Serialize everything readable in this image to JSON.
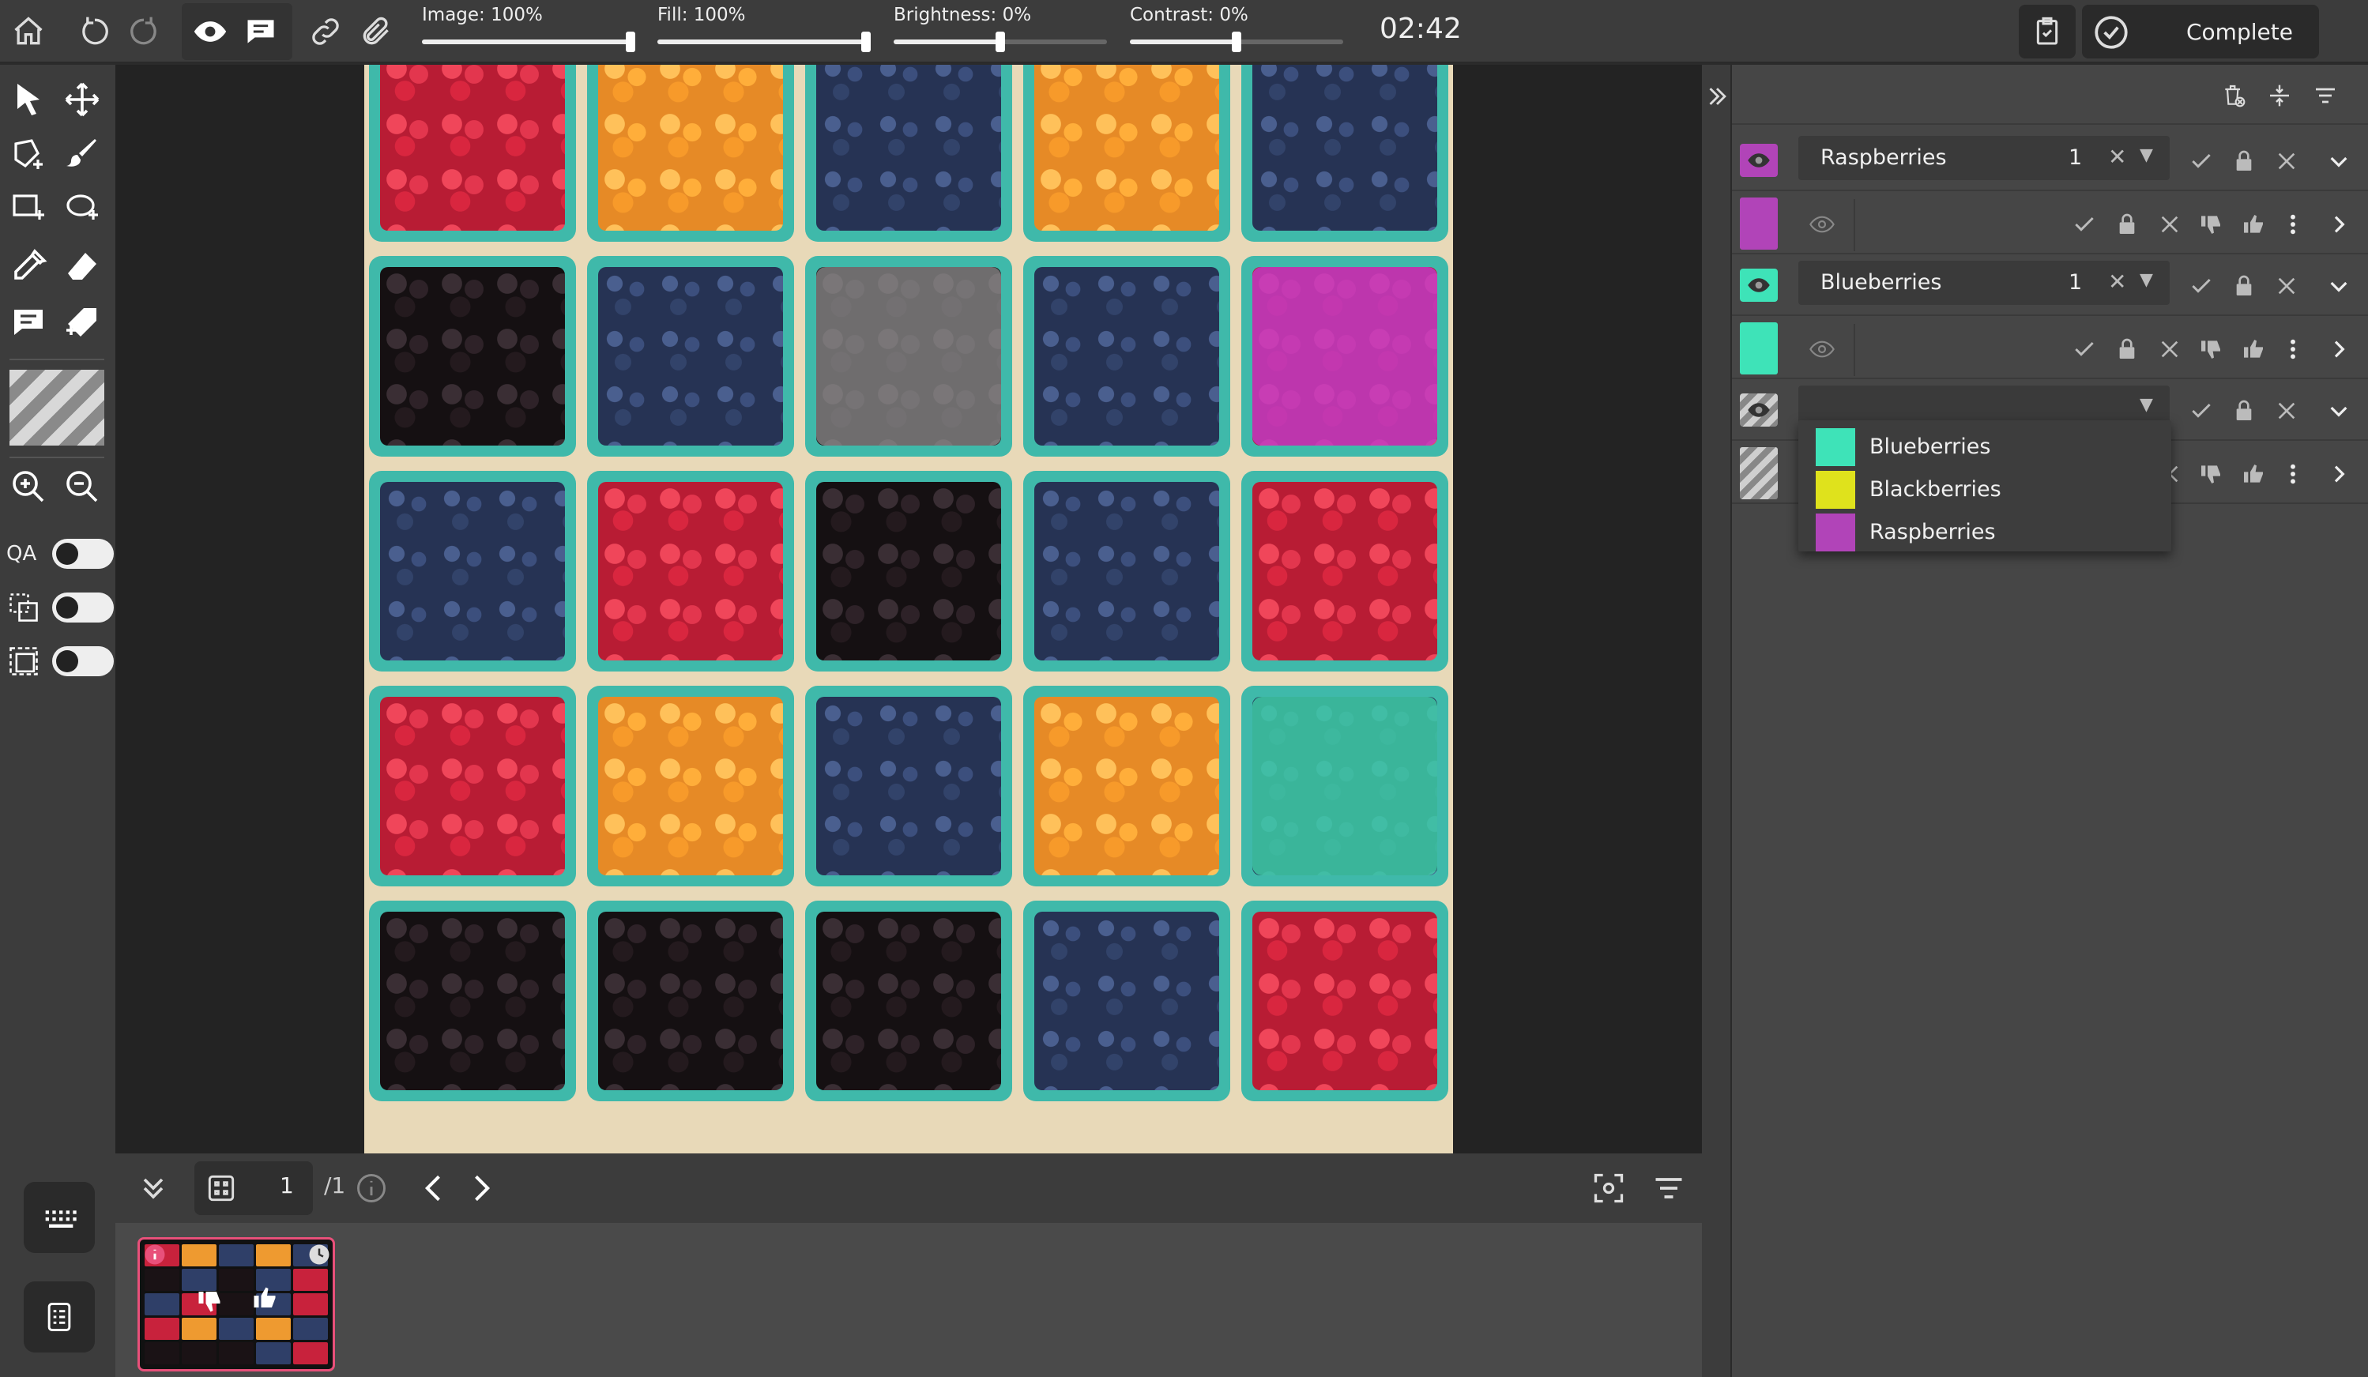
{
  "toolbar": {
    "sliders": [
      {
        "label": "Image: 100%",
        "value": 1.0
      },
      {
        "label": "Fill: 100%",
        "value": 1.0
      },
      {
        "label": "Brightness: 0%",
        "value": 0.5
      },
      {
        "label": "Contrast: 0%",
        "value": 0.5
      }
    ],
    "timer": "02:42",
    "complete_label": "Complete"
  },
  "left_tools": {
    "qa_label": "QA"
  },
  "pager": {
    "current_page": "1",
    "total_pages": "/1"
  },
  "right_panel": {
    "annotations": [
      {
        "class": "Raspberries",
        "count": "1",
        "color": "#b144b8"
      },
      {
        "class": "Blueberries",
        "count": "1",
        "color": "#3ee3b8"
      },
      {
        "class": "",
        "count": "",
        "color": "#9a9a9a"
      }
    ],
    "class_options": [
      {
        "label": "Blueberries",
        "color": "#3ee3b8"
      },
      {
        "label": "Blackberries",
        "color": "#dfe21c"
      },
      {
        "label": "Raspberries",
        "color": "#b144b8"
      }
    ]
  },
  "image_grid": {
    "rows": [
      [
        "raspberry",
        "golden-raspberry",
        "blueberry",
        "golden-raspberry",
        "blueberry"
      ],
      [
        "blackberry",
        "blueberry",
        "blackberry",
        "blueberry",
        "raspberry"
      ],
      [
        "blueberry",
        "raspberry",
        "blackberry",
        "blueberry",
        "raspberry"
      ],
      [
        "raspberry",
        "golden-raspberry",
        "blueberry",
        "golden-raspberry",
        "blueberry"
      ],
      [
        "blackberry",
        "blackberry",
        "blackberry",
        "blueberry",
        "raspberry"
      ]
    ],
    "masks": [
      {
        "row": 1,
        "col": 2,
        "class": "unassigned",
        "color": "#969696"
      },
      {
        "row": 1,
        "col": 4,
        "class": "Raspberries",
        "color": "#be3cc8"
      },
      {
        "row": 3,
        "col": 4,
        "class": "Blueberries",
        "color": "#40d2aa"
      }
    ]
  }
}
